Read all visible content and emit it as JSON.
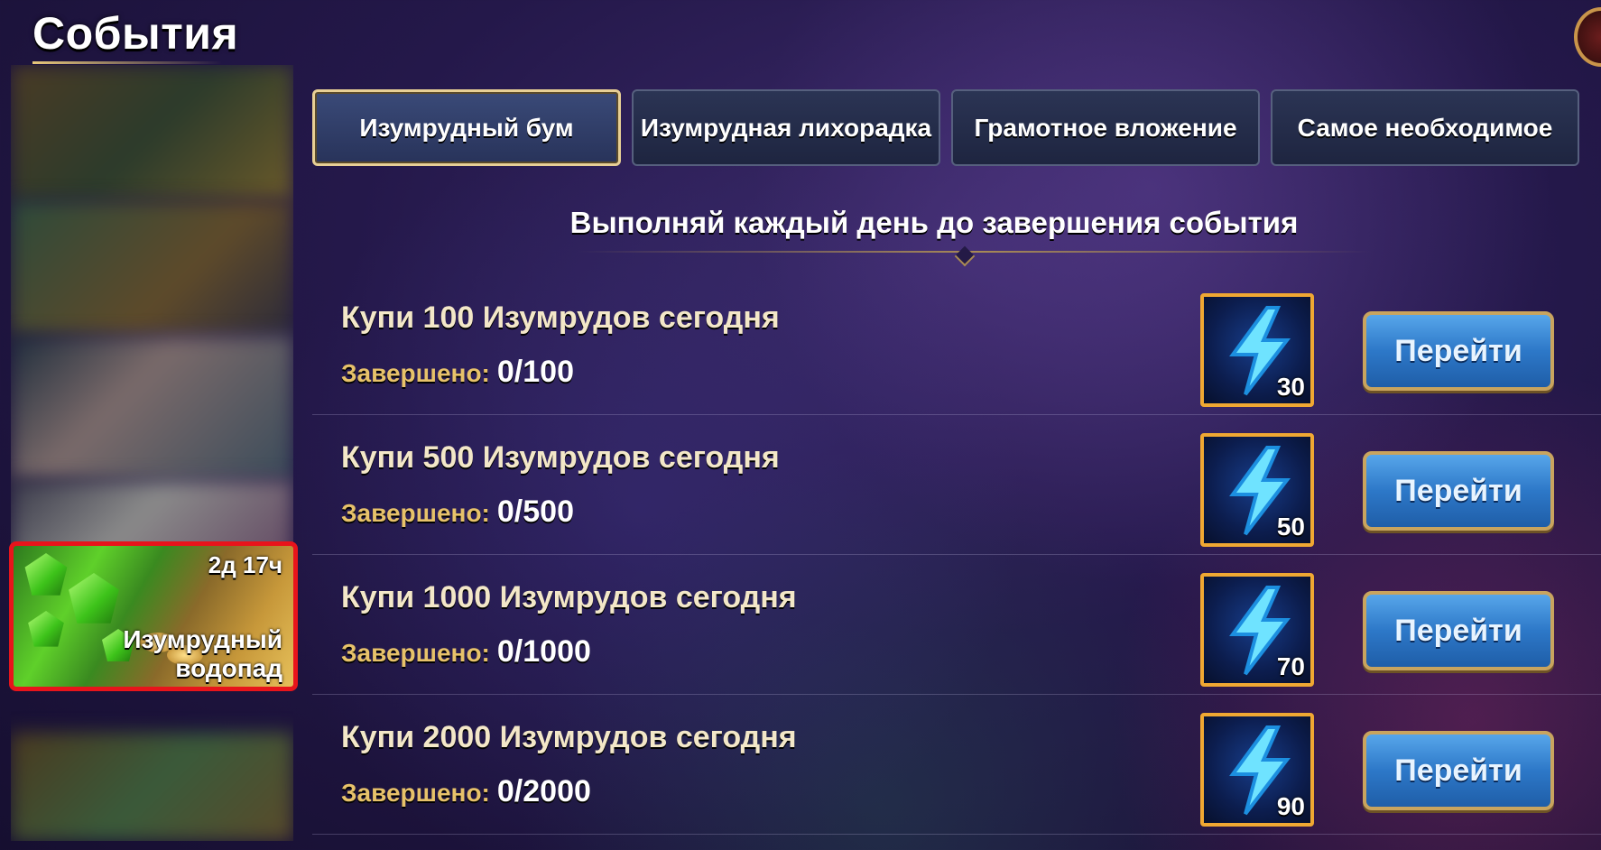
{
  "page": {
    "title": "События"
  },
  "sidebar": {
    "selected_event": {
      "timer": "2д 17ч",
      "name": "Изумрудный водопад"
    }
  },
  "tabs": [
    {
      "label": "Изумрудный бум",
      "active": true
    },
    {
      "label": "Изумрудная лихорадка",
      "active": false
    },
    {
      "label": "Грамотное вложение",
      "active": false
    },
    {
      "label": "Самое необходимое",
      "active": false
    }
  ],
  "subtitle": "Выполняй каждый день до завершения события",
  "progress_label": "Завершено:",
  "go_label": "Перейти",
  "tasks": [
    {
      "title": "Купи 100 Изумрудов сегодня",
      "progress": "0/100",
      "reward_icon": "energy-bolt-icon",
      "reward_qty": "30"
    },
    {
      "title": "Купи 500 Изумрудов сегодня",
      "progress": "0/500",
      "reward_icon": "energy-bolt-icon",
      "reward_qty": "50"
    },
    {
      "title": "Купи 1000 Изумрудов сегодня",
      "progress": "0/1000",
      "reward_icon": "energy-bolt-icon",
      "reward_qty": "70"
    },
    {
      "title": "Купи 2000 Изумрудов сегодня",
      "progress": "0/2000",
      "reward_icon": "energy-bolt-icon",
      "reward_qty": "90"
    }
  ],
  "colors": {
    "accent_gold": "#e7c26a",
    "button_blue": "#2d78c8",
    "reward_border": "#f0a832",
    "selection_red": "#e8141b"
  }
}
